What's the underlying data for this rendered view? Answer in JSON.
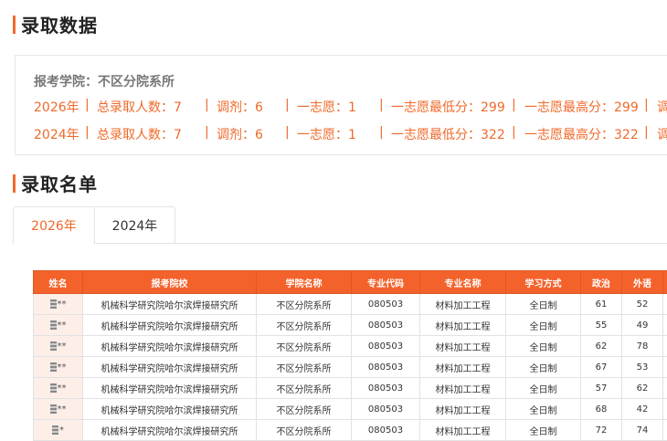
{
  "section1": {
    "title": "录取数据"
  },
  "stats": {
    "college_line": "报考学院：不区分院系所",
    "rows": [
      {
        "year": "2026年",
        "total": "总录取人数：7",
        "adjust": "调剂：6",
        "first": "一志愿：1",
        "min": "一志愿最低分：299",
        "max": "一志愿最高分：299",
        "trunc": "调"
      },
      {
        "year": "2024年",
        "total": "总录取人数：7",
        "adjust": "调剂：6",
        "first": "一志愿：1",
        "min": "一志愿最低分：322",
        "max": "一志愿最高分：322",
        "trunc": "调"
      }
    ],
    "separator": "|"
  },
  "section2": {
    "title": "录取名单"
  },
  "tabs": [
    {
      "label": "2026年",
      "active": true
    },
    {
      "label": "2024年",
      "active": false
    }
  ],
  "table": {
    "headers": [
      "姓名",
      "报考院校",
      "学院名称",
      "专业代码",
      "专业名称",
      "学习方式",
      "政治",
      "外语",
      ""
    ],
    "rows": [
      [
        "**",
        "机械科学研究院哈尔滨焊接研究所",
        "不区分院系所",
        "080503",
        "材料加工工程",
        "全日制",
        "61",
        "52"
      ],
      [
        "**",
        "机械科学研究院哈尔滨焊接研究所",
        "不区分院系所",
        "080503",
        "材料加工工程",
        "全日制",
        "55",
        "49"
      ],
      [
        "**",
        "机械科学研究院哈尔滨焊接研究所",
        "不区分院系所",
        "080503",
        "材料加工工程",
        "全日制",
        "62",
        "78"
      ],
      [
        "**",
        "机械科学研究院哈尔滨焊接研究所",
        "不区分院系所",
        "080503",
        "材料加工工程",
        "全日制",
        "67",
        "53"
      ],
      [
        "**",
        "机械科学研究院哈尔滨焊接研究所",
        "不区分院系所",
        "080503",
        "材料加工工程",
        "全日制",
        "57",
        "62"
      ],
      [
        "**",
        "机械科学研究院哈尔滨焊接研究所",
        "不区分院系所",
        "080503",
        "材料加工工程",
        "全日制",
        "68",
        "42"
      ],
      [
        "*",
        "机械科学研究院哈尔滨焊接研究所",
        "不区分院系所",
        "080503",
        "材料加工工程",
        "全日制",
        "72",
        "74"
      ]
    ]
  },
  "colors": {
    "accent": "#f06a2a",
    "header_bg": "#f4622b",
    "name_cell_bg": "#fdeee8"
  }
}
